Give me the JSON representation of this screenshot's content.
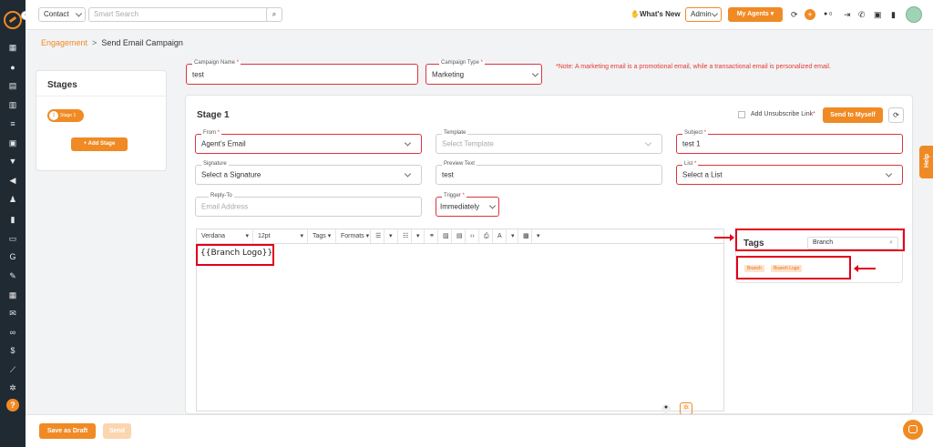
{
  "topbar": {
    "module_select": "Contact",
    "search_placeholder": "Smart Search",
    "whats_new": "What's New",
    "role_select": "Admin",
    "my_agents": "My Agents",
    "badge_label": "0"
  },
  "breadcrumb": {
    "parent": "Engagement",
    "separator": ">",
    "current": "Send Email Campaign"
  },
  "stages_panel": {
    "title": "Stages",
    "stage_number": "1",
    "stage_label": "Stage 1",
    "add_stage": "+ Add Stage"
  },
  "campaign": {
    "name_label": "Campaign Name",
    "name_value": "test",
    "type_label": "Campaign Type",
    "type_value": "Marketing",
    "note": "*Note: A marketing email is a promotional email, while a transactional email is personalized email."
  },
  "stage": {
    "title": "Stage 1",
    "unsubscribe_label": "Add Unsubscribe Link",
    "send_to_myself": "Send to Myself",
    "from_label": "From",
    "from_value": "Agent's Email",
    "template_label": "Template",
    "template_placeholder": "Select Template",
    "subject_label": "Subject",
    "subject_value": "test 1",
    "signature_label": "Signature",
    "signature_value": "Select a Signature",
    "preview_label": "Preview Text",
    "preview_value": "test",
    "list_label": "List",
    "list_value": "Select a List",
    "replyto_label": "Reply-To",
    "replyto_placeholder": "Email Address",
    "trigger_label": "Trigger",
    "trigger_value": "Immediately",
    "required_mark": "*"
  },
  "editor": {
    "toolbar": {
      "font": "Verdana",
      "size": "12pt",
      "tags": "Tags",
      "formats": "Formats"
    },
    "content": "{{Branch Logo}}"
  },
  "tags_panel": {
    "title": "Tags",
    "search_value": "Branch",
    "chips": [
      "Branch",
      "Branch Logo"
    ]
  },
  "help_tab": "Help",
  "footer": {
    "save_draft": "Save as Draft",
    "send": "Send"
  },
  "colors": {
    "accent": "#f08a24",
    "sidebar": "#1f2a33",
    "annotation": "#e2001a",
    "note": "#e53935"
  }
}
